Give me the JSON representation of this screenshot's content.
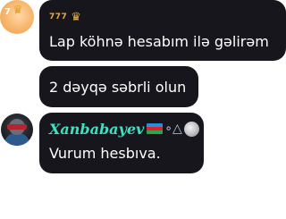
{
  "messages": [
    {
      "avatar": {
        "badge_text": "7",
        "crown": "♛"
      },
      "sender": "777",
      "sender_icon": "♛",
      "text": "Lap köhnə hesabım ilə gəlirəm"
    },
    {
      "text": "2 dəyqə səbrli olun"
    },
    {
      "sender": "Xanbabayev",
      "sender_icons": [
        "azerbaijan-flag-icon",
        "triangle-symbol-icon",
        "moon-icon"
      ],
      "deco_glyph": "∘△",
      "text": "Vurum hesbıva."
    }
  ],
  "colors": {
    "bubble": "#16161c",
    "sender_777": "#f0a93a",
    "sender_xanbabayev": "#3ee0c0"
  }
}
